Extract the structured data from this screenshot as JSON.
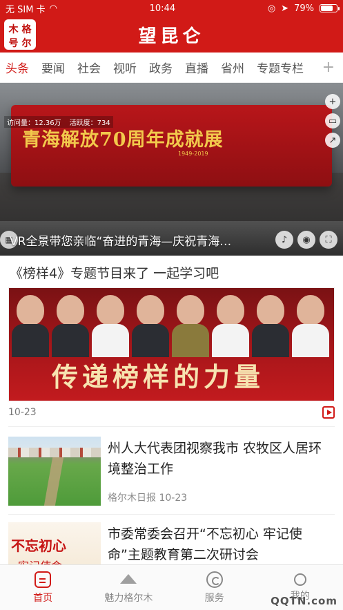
{
  "status_bar": {
    "carrier": "无 SIM 卡",
    "time": "10:44",
    "battery_percent": "79%",
    "battery_level": 0.79
  },
  "header": {
    "logo_chars": [
      "木",
      "格",
      "号",
      "尔"
    ],
    "title": "望昆仑"
  },
  "tabs": [
    {
      "label": "头条",
      "active": true
    },
    {
      "label": "要闻"
    },
    {
      "label": "社会"
    },
    {
      "label": "视听"
    },
    {
      "label": "政务"
    },
    {
      "label": "直播"
    },
    {
      "label": "省州"
    },
    {
      "label": "专题专栏"
    }
  ],
  "tabs_more": "+",
  "hero": {
    "board_text": "青海解放70周年成就展",
    "board_badge": "1949-2019",
    "stats": [
      "访问量：12.36万",
      "活跃度：734"
    ],
    "caption": "VR全景带您亲临“奋进的青海—庆祝青海…"
  },
  "featured": {
    "title": "《榜样4》专题节目来了 一起学习吧",
    "image_slogan": "传递榜样的力量",
    "date": "10-23"
  },
  "articles": [
    {
      "headline": "州人大代表团视察我市 农牧区人居环境整治工作",
      "source": "格尔木日报 10-23"
    },
    {
      "headline": "市委常委会召开“不忘初心 牢记使命”主题教育第二次研讨会",
      "thumb_text_1": "不忘初心",
      "thumb_text_2": "牢记使命"
    }
  ],
  "bottom_nav": [
    {
      "label": "首页",
      "icon": "home-icon",
      "active": true
    },
    {
      "label": "魅力格尔木",
      "icon": "mountain-icon"
    },
    {
      "label": "服务",
      "icon": "service-icon"
    },
    {
      "label": "我的",
      "icon": "user-icon"
    }
  ],
  "watermark": "QQTN.com",
  "colors": {
    "brand_red": "#d11a17",
    "text_dark": "#222222",
    "text_gray": "#888888"
  }
}
